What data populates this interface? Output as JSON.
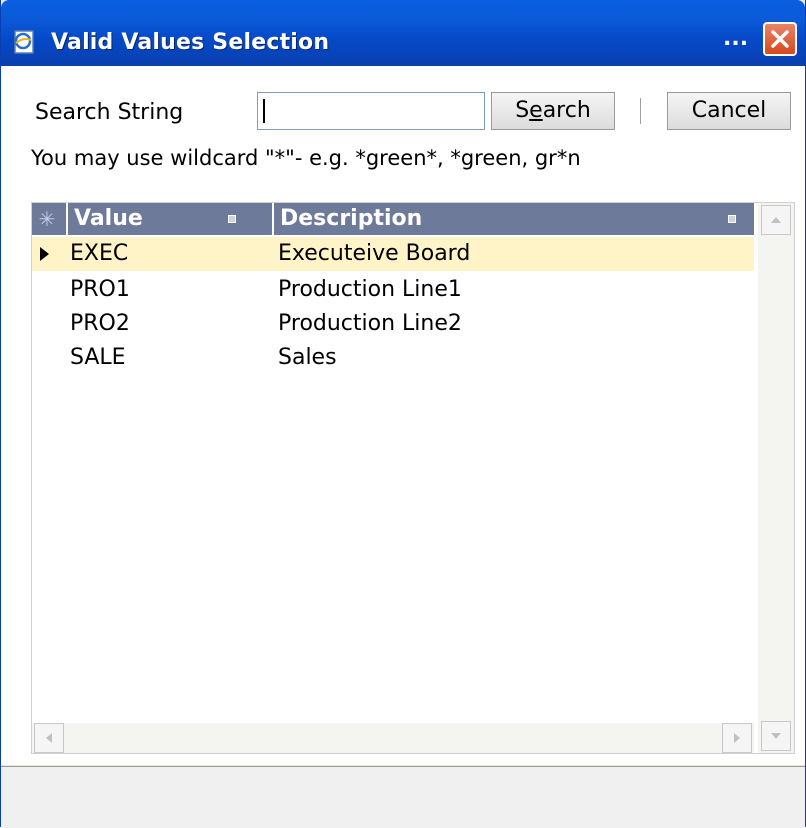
{
  "window": {
    "title": "Valid Values Selection",
    "title_overflow": "...",
    "title_icon": "browser-page-icon",
    "close_icon": "close-x-icon"
  },
  "search": {
    "label": "Search String",
    "value": "",
    "search_button": "Search",
    "search_access_key": "e",
    "cancel_button": "Cancel",
    "hint": "You may use wildcard \"*\"- e.g. *green*, *green, gr*n"
  },
  "grid": {
    "corner_icon": "asterisk-icon",
    "columns": [
      "Value",
      "Description"
    ],
    "column_marker_icon": "column-menu-icon",
    "rows": [
      {
        "value": "EXEC",
        "description": "Executeive Board",
        "selected": true
      },
      {
        "value": "PRO1",
        "description": "Production Line1",
        "selected": false
      },
      {
        "value": "PRO2",
        "description": "Production Line2",
        "selected": false
      },
      {
        "value": "SALE",
        "description": "Sales",
        "selected": false
      }
    ],
    "row_indicator_icon": "triangle-right-icon"
  },
  "colors": {
    "title_bar": "#0a5ee0",
    "header_bg": "#6e7a9a",
    "selected_row": "#fff4c8",
    "close_button": "#d6481f"
  }
}
